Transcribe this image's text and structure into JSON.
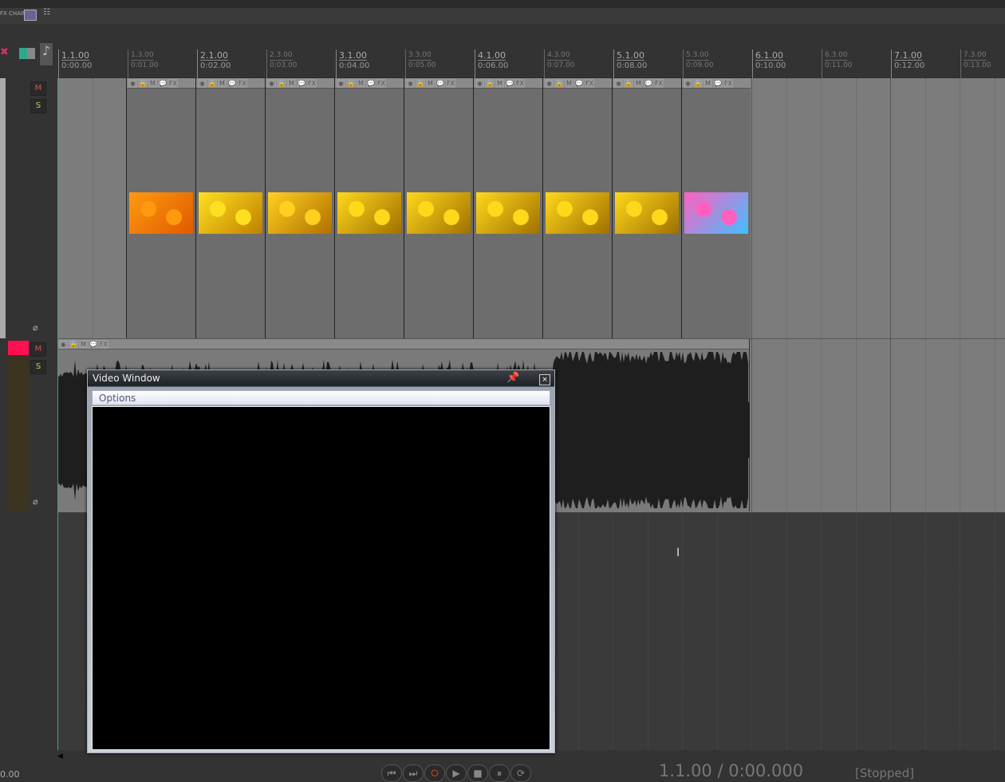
{
  "ruler": [
    {
      "bar": "1.1.00",
      "time": "0:00.00",
      "major": true
    },
    {
      "bar": "1.3.00",
      "time": "0:01.00",
      "major": false
    },
    {
      "bar": "2.1.00",
      "time": "0:02.00",
      "major": true
    },
    {
      "bar": "2.3.00",
      "time": "0:03.00",
      "major": false
    },
    {
      "bar": "3.1.00",
      "time": "0:04.00",
      "major": true
    },
    {
      "bar": "3.3.00",
      "time": "0:05.00",
      "major": false
    },
    {
      "bar": "4.1.00",
      "time": "0:06.00",
      "major": true
    },
    {
      "bar": "4.3.00",
      "time": "0:07.00",
      "major": false
    },
    {
      "bar": "5.1.00",
      "time": "0:08.00",
      "major": true
    },
    {
      "bar": "5.3.00",
      "time": "0:09.00",
      "major": false
    },
    {
      "bar": "6.1.00",
      "time": "0:10.00",
      "major": true
    },
    {
      "bar": "6.3.00",
      "time": "0:11.00",
      "major": false
    },
    {
      "bar": "7.1.00",
      "time": "0:12.00",
      "major": true
    },
    {
      "bar": "7.3.00",
      "time": "0:13.00",
      "major": false
    }
  ],
  "toolbar": {
    "fx_chain": "FX CHAIN"
  },
  "tracks": [
    {
      "mute": "M",
      "solo": "S",
      "phase": "⌀"
    },
    {
      "mute": "M",
      "solo": "S",
      "phase": "⌀",
      "color": "#ff1050"
    }
  ],
  "item_buttons": [
    "◉",
    "🔒",
    "M",
    "💬",
    "FX"
  ],
  "video_items": [
    {
      "colors": [
        "#ff9a10",
        "#e05a00"
      ]
    },
    {
      "colors": [
        "#ffe020",
        "#c08000"
      ]
    },
    {
      "colors": [
        "#ffd020",
        "#b07000"
      ]
    },
    {
      "colors": [
        "#ffd81c",
        "#a07000"
      ]
    },
    {
      "colors": [
        "#ffd81c",
        "#a07000"
      ]
    },
    {
      "colors": [
        "#ffd81c",
        "#a07000"
      ]
    },
    {
      "colors": [
        "#ffd81c",
        "#a07000"
      ]
    },
    {
      "colors": [
        "#ffd81c",
        "#a07000"
      ]
    },
    {
      "colors": [
        "#ff60c0",
        "#40c0ff"
      ]
    }
  ],
  "video_window": {
    "title": "Video Window",
    "pin": "📌",
    "close": "×",
    "menu": "Options"
  },
  "transport": {
    "buttons": [
      "⏮",
      "⏭",
      "⭘",
      "▶",
      "■",
      "⏸",
      "⟳"
    ],
    "position": "1.1.00 / 0:00.000",
    "status": "[Stopped]",
    "left_readout": "0.00"
  },
  "accent": "#2ea88a"
}
